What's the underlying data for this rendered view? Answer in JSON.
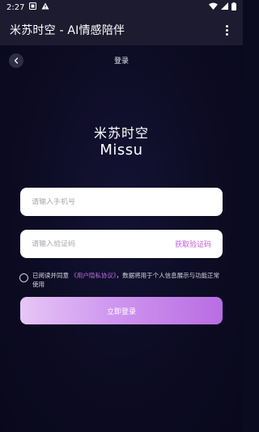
{
  "status_bar": {
    "time": "2:27"
  },
  "app_bar": {
    "title": "米苏时空 - AI情感陪伴"
  },
  "page": {
    "title": "登录"
  },
  "brand": {
    "name_cn": "米苏时空",
    "name_en": "Missu"
  },
  "phone_field": {
    "placeholder": "请输入手机号",
    "value": ""
  },
  "code_field": {
    "placeholder": "请输入验证码",
    "value": "",
    "get_code_label": "获取验证码"
  },
  "agreement": {
    "prefix": "已阅读并同意",
    "link": "《用户隐私协议》",
    "suffix": "，数据将用于个人信息展示与功能正常使用",
    "checked": false
  },
  "login_button": {
    "label": "立即登录"
  },
  "colors": {
    "accent": "#c45ad8",
    "button_start": "#e6c6f6",
    "button_end": "#b96ce3",
    "background": "#0b0b20",
    "app_bar": "#1d1b2f"
  }
}
